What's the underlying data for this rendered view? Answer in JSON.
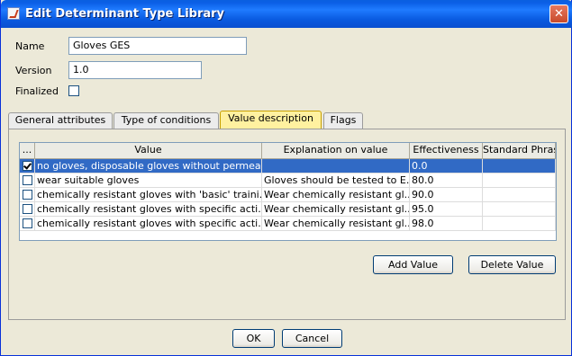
{
  "window": {
    "title": "Edit Determinant Type Library",
    "close_glyph": "✕"
  },
  "form": {
    "name_label": "Name",
    "name_value": "Gloves GES",
    "version_label": "Version",
    "version_value": "1.0",
    "finalized_label": "Finalized",
    "finalized_checked": false
  },
  "tabs": [
    {
      "label": "General attributes",
      "active": false
    },
    {
      "label": "Type of conditions",
      "active": false
    },
    {
      "label": "Value description",
      "active": true
    },
    {
      "label": "Flags",
      "active": false
    }
  ],
  "table": {
    "columns": [
      "...",
      "Value",
      "Explanation on value",
      "Effectiveness",
      "Standard Phras..."
    ],
    "rows": [
      {
        "checked": true,
        "selected": true,
        "value": "no gloves, disposable gloves without permea...",
        "explanation": "",
        "effectiveness": "0.0",
        "standard": ""
      },
      {
        "checked": false,
        "selected": false,
        "value": "wear suitable gloves",
        "explanation": "Gloves should be tested to E...",
        "effectiveness": "80.0",
        "standard": ""
      },
      {
        "checked": false,
        "selected": false,
        "value": "chemically resistant gloves with 'basic' traini...",
        "explanation": "Wear chemically resistant gl...",
        "effectiveness": "90.0",
        "standard": ""
      },
      {
        "checked": false,
        "selected": false,
        "value": "chemically resistant gloves with specific acti...",
        "explanation": "Wear chemically resistant gl...",
        "effectiveness": "95.0",
        "standard": ""
      },
      {
        "checked": false,
        "selected": false,
        "value": "chemically resistant gloves with specific acti...",
        "explanation": "Wear chemically resistant gl...",
        "effectiveness": "98.0",
        "standard": ""
      }
    ]
  },
  "actions": {
    "add_value": "Add Value",
    "delete_value": "Delete Value"
  },
  "footer": {
    "ok": "OK",
    "cancel": "Cancel"
  },
  "colors": {
    "titlebar": "#0a5ae0",
    "selection": "#316ac5",
    "active_tab": "#fff1a0",
    "dialog_bg": "#ece9d8"
  }
}
